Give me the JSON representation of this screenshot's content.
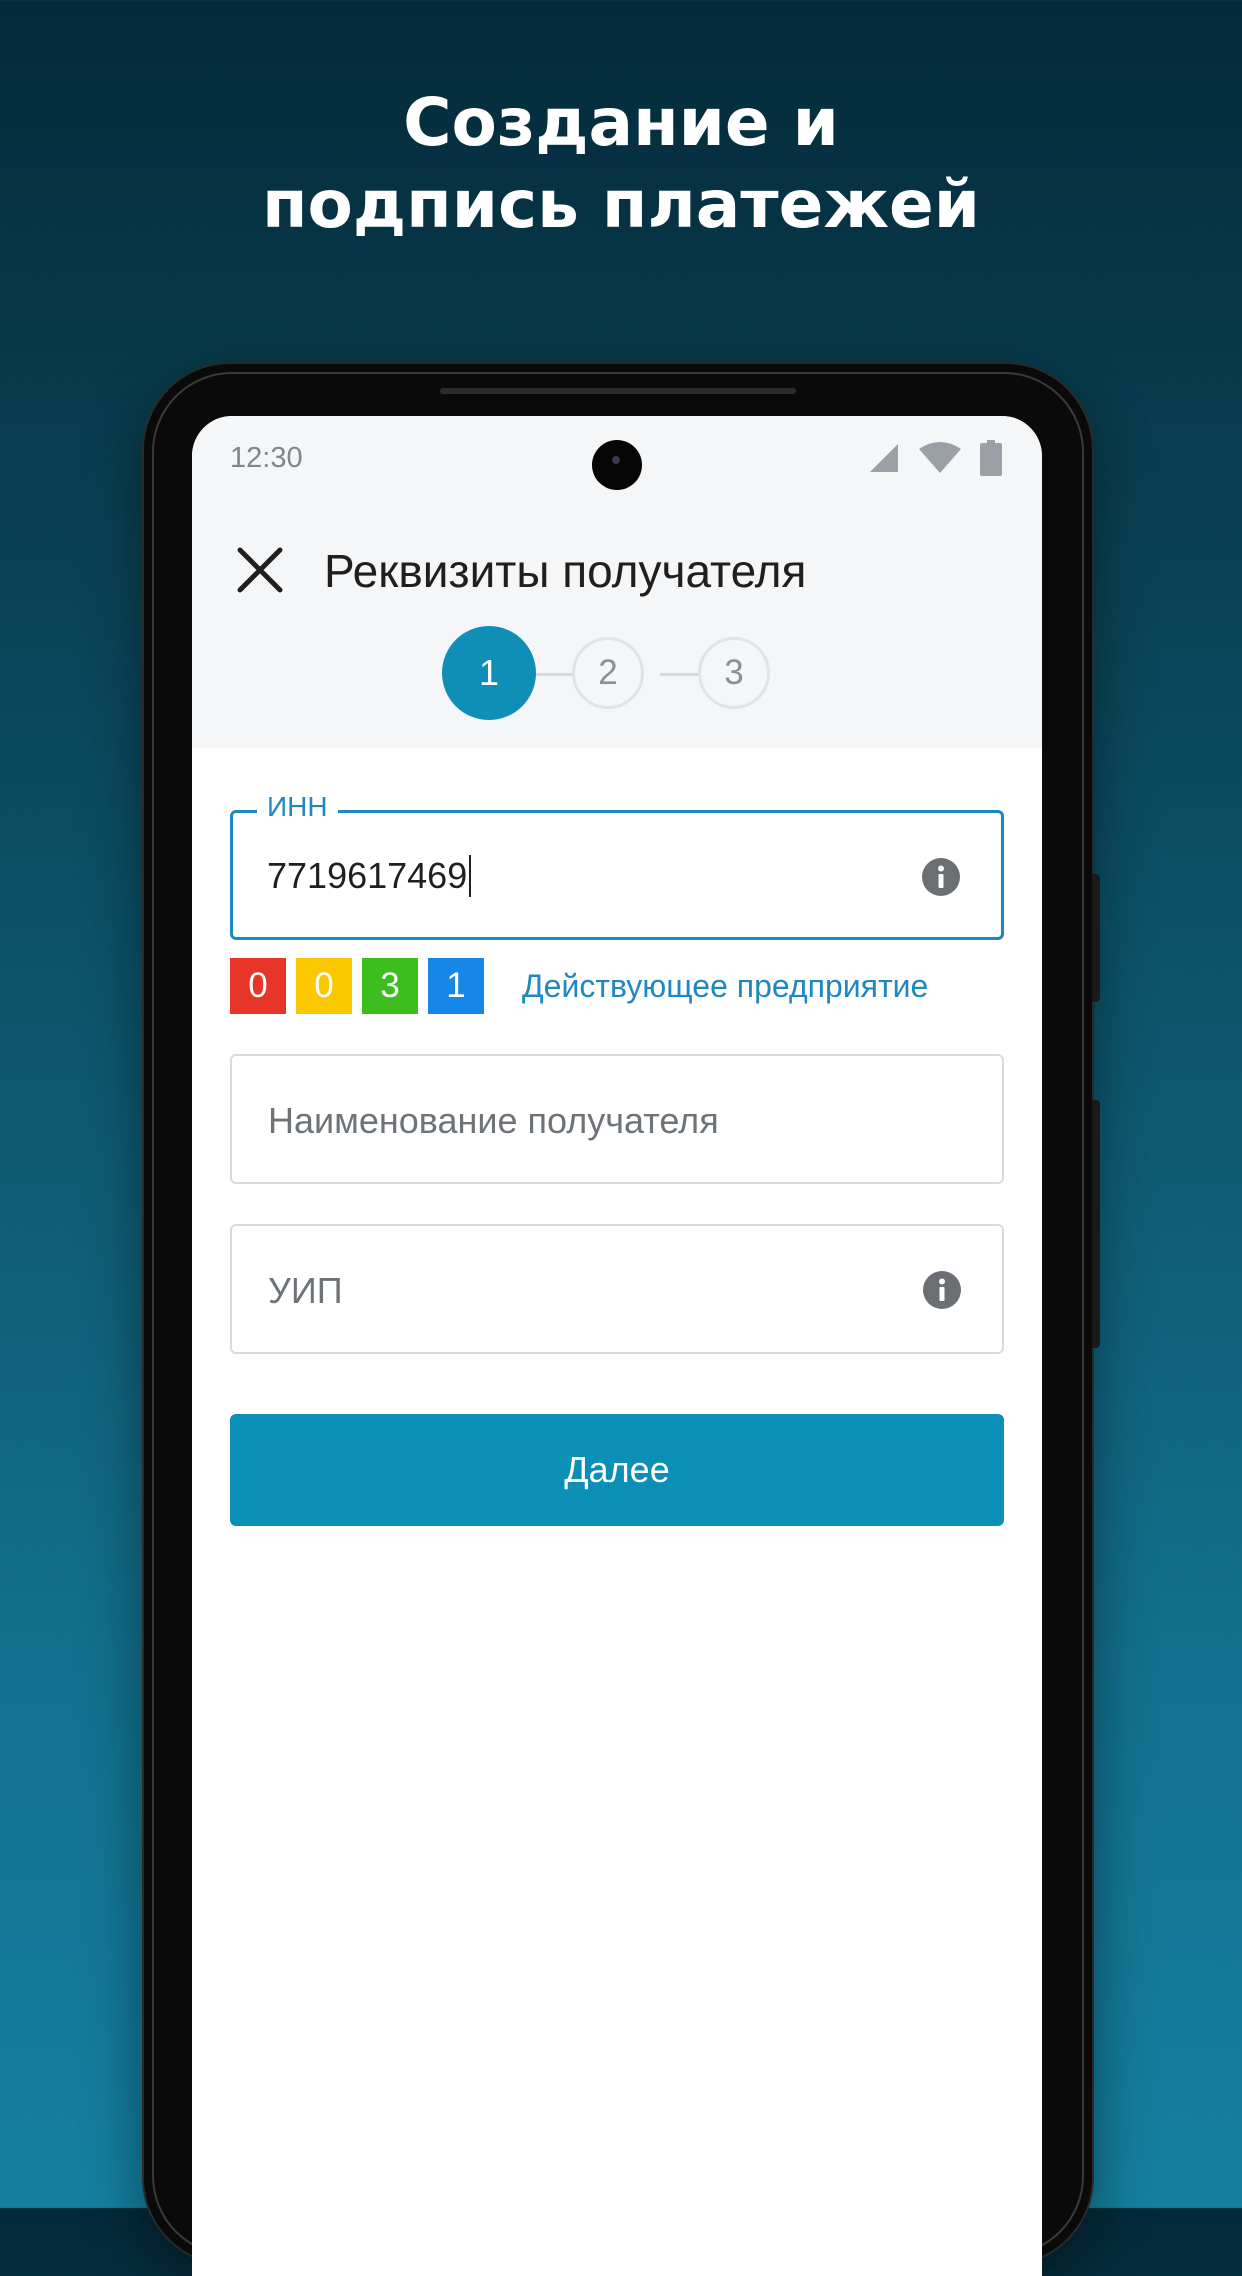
{
  "promo": {
    "title_line1": "Создание и",
    "title_line2": "подпись платежей"
  },
  "status_bar": {
    "time": "12:30",
    "icons": [
      "cell-signal-icon",
      "wifi-icon",
      "battery-icon"
    ]
  },
  "header": {
    "title": "Реквизиты получателя",
    "close_icon": "close-icon"
  },
  "stepper": {
    "current_step": 1,
    "steps": [
      "1",
      "2",
      "3"
    ]
  },
  "form": {
    "inn": {
      "label": "ИНН",
      "value": "7719617469",
      "icon": "info-icon"
    },
    "badges": [
      {
        "value": "0",
        "color": "#e8352a"
      },
      {
        "value": "0",
        "color": "#fbc800"
      },
      {
        "value": "3",
        "color": "#3cbf1e"
      },
      {
        "value": "1",
        "color": "#1686e8"
      }
    ],
    "company_status": "Действующее предприятие",
    "recipient_name": {
      "placeholder": "Наименование получателя"
    },
    "uip": {
      "placeholder": "УИП",
      "icon": "info-icon"
    }
  },
  "actions": {
    "next_label": "Далее"
  },
  "colors": {
    "accent": "#0a8fb6",
    "link": "#1f88c0",
    "background_top": "#042a3a",
    "background_bottom": "#14809f"
  }
}
